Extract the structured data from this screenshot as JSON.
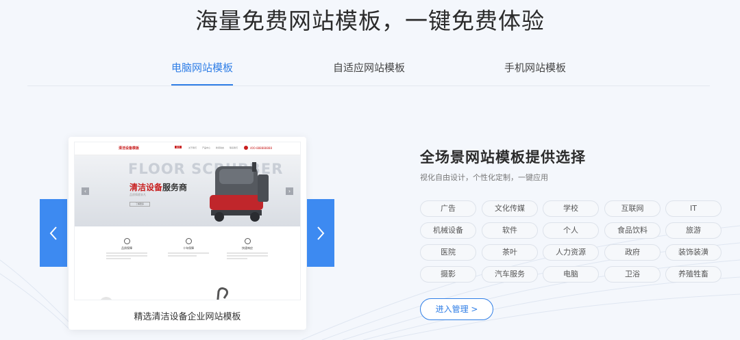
{
  "headline": "海量免费网站模板，一键免费体验",
  "tabs": [
    {
      "label": "电脑网站模板",
      "active": true
    },
    {
      "label": "自适应网站模板",
      "active": false
    },
    {
      "label": "手机网站模板",
      "active": false
    }
  ],
  "carousel": {
    "prev_icon": "chevron-left-icon",
    "next_icon": "chevron-right-icon",
    "card": {
      "title": "精选清洁设备企业网站模板",
      "preview": {
        "logo": "清洁设备模板",
        "menu": [
          "首页",
          "关于我们",
          "产品中心",
          "新闻动态",
          "联系我们"
        ],
        "phone": "400-888888888",
        "banner_bg_text": "FLOOR SCRUBBER",
        "banner_title_red": "清洁设备",
        "banner_title_dark": "服务商",
        "banner_sub": "品质铸就非凡",
        "banner_btn": "了解更多",
        "features": [
          "品质保障",
          "十年保障",
          "快速响应"
        ]
      }
    }
  },
  "info": {
    "title": "全场景网站模板提供选择",
    "subtitle": "视化自由设计，个性化定制，一键应用",
    "tags": [
      "广告",
      "文化传媒",
      "学校",
      "互联网",
      "IT",
      "机械设备",
      "软件",
      "个人",
      "食品饮料",
      "旅游",
      "医院",
      "茶叶",
      "人力资源",
      "政府",
      "装饰装潢",
      "摄影",
      "汽车服务",
      "电脑",
      "卫浴",
      "养殖牲畜"
    ],
    "enter_button": "进入管理 >"
  },
  "colors": {
    "accent": "#2f7ee6",
    "arrow_bg": "#3d8af1",
    "page_bg": "#f4f7fc",
    "brand_red": "#c81e1e"
  }
}
